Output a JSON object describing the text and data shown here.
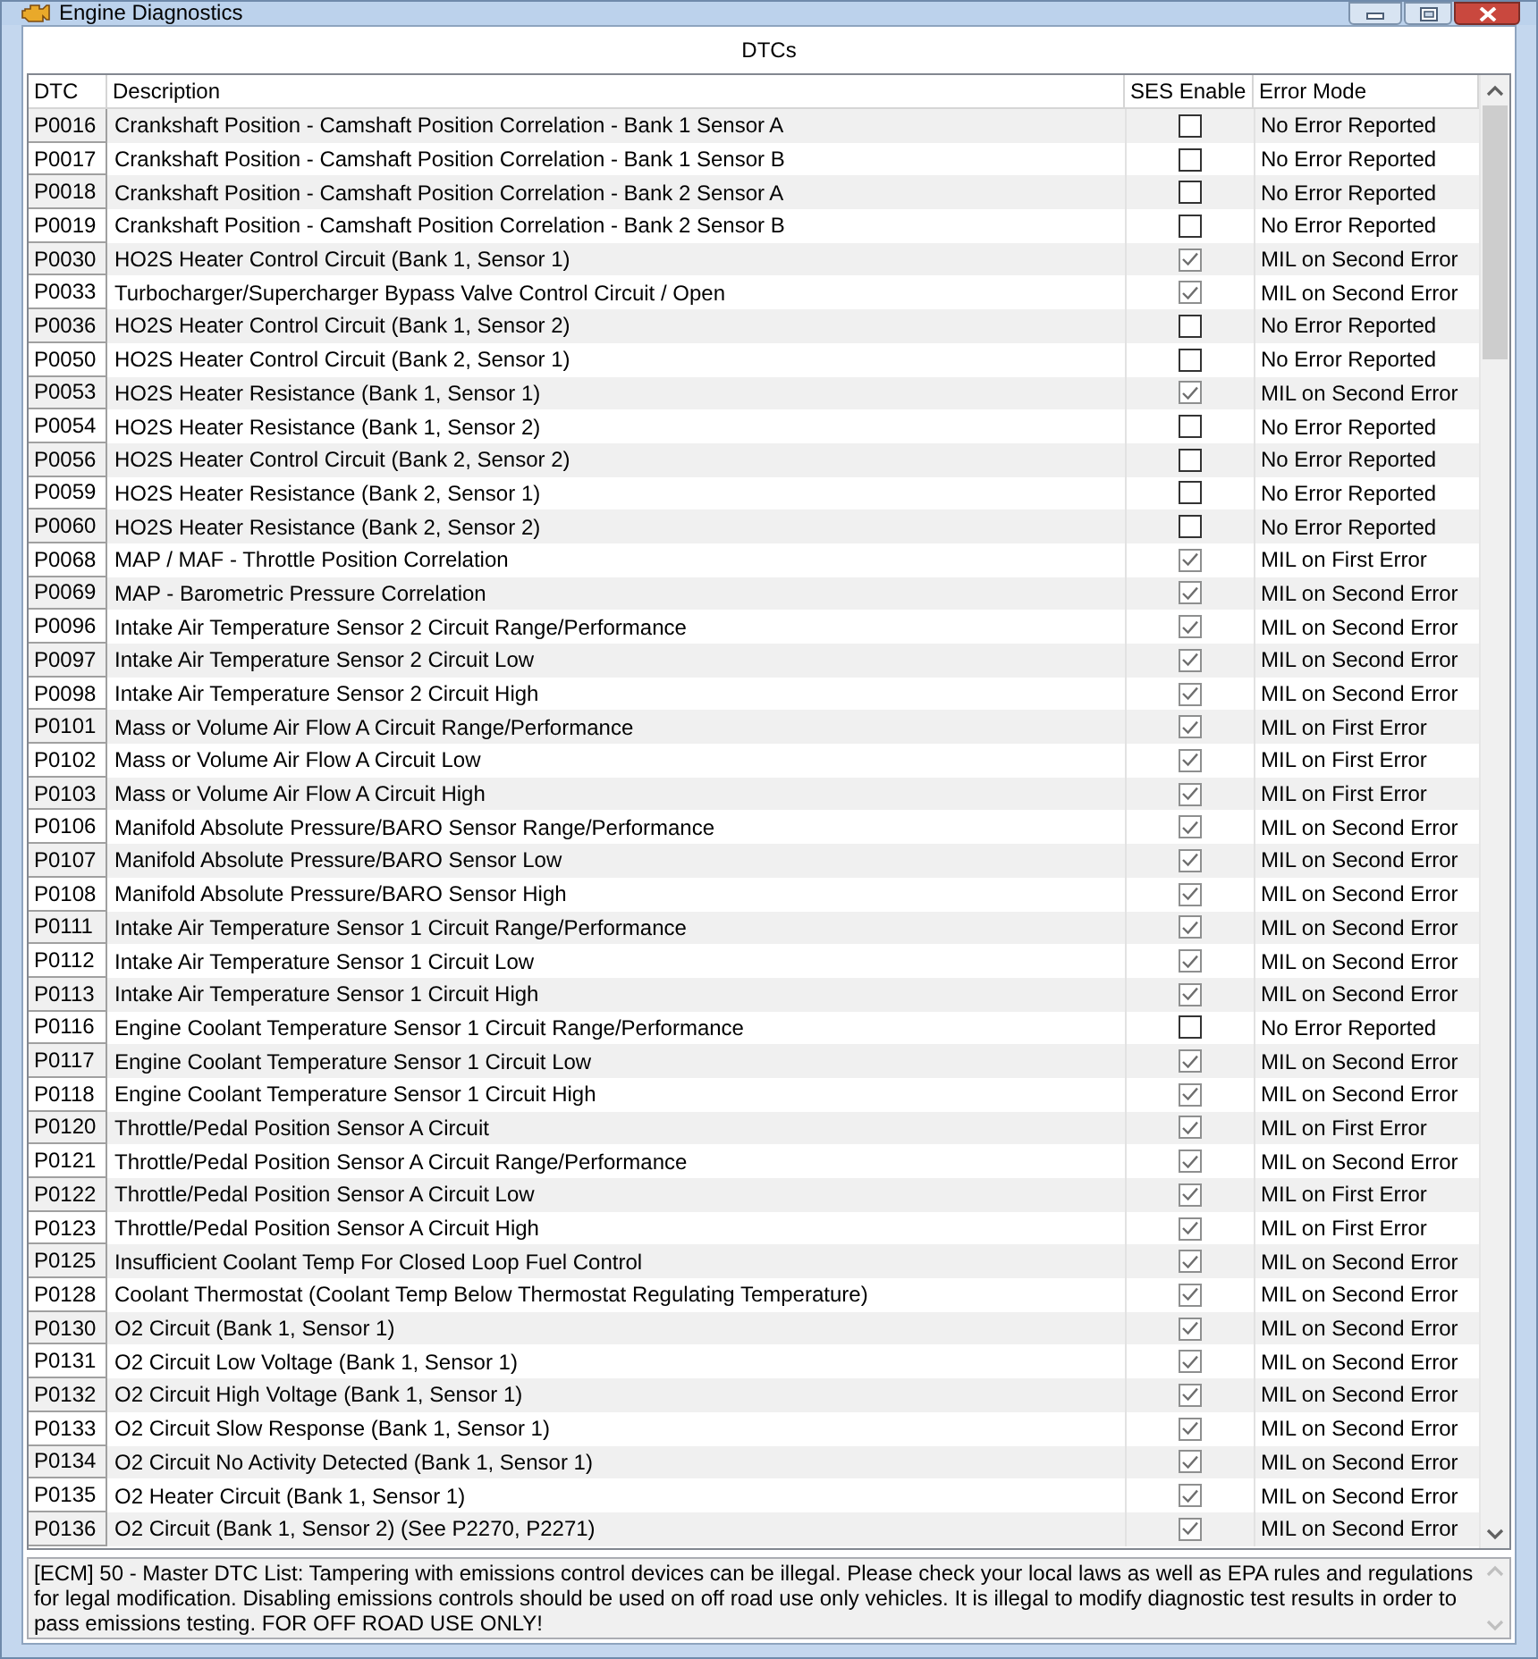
{
  "window": {
    "title": "Engine Diagnostics"
  },
  "panel": {
    "title": "DTCs"
  },
  "table": {
    "columns": [
      "DTC",
      "Description",
      "SES Enable",
      "Error Mode"
    ],
    "rows": [
      {
        "dtc": "P0016",
        "description": "Crankshaft Position - Camshaft Position Correlation - Bank 1 Sensor A",
        "checked": false,
        "error_mode": "No Error Reported"
      },
      {
        "dtc": "P0017",
        "description": "Crankshaft Position - Camshaft Position Correlation - Bank 1 Sensor B",
        "checked": false,
        "error_mode": "No Error Reported"
      },
      {
        "dtc": "P0018",
        "description": "Crankshaft Position - Camshaft Position Correlation - Bank 2 Sensor A",
        "checked": false,
        "error_mode": "No Error Reported"
      },
      {
        "dtc": "P0019",
        "description": "Crankshaft Position - Camshaft Position Correlation - Bank 2 Sensor B",
        "checked": false,
        "error_mode": "No Error Reported"
      },
      {
        "dtc": "P0030",
        "description": "HO2S Heater Control Circuit (Bank 1, Sensor 1)",
        "checked": true,
        "error_mode": "MIL on Second Error"
      },
      {
        "dtc": "P0033",
        "description": "Turbocharger/Supercharger Bypass Valve Control Circuit / Open",
        "checked": true,
        "error_mode": "MIL on Second Error"
      },
      {
        "dtc": "P0036",
        "description": "HO2S Heater Control Circuit (Bank 1, Sensor 2)",
        "checked": false,
        "error_mode": "No Error Reported"
      },
      {
        "dtc": "P0050",
        "description": "HO2S Heater Control Circuit (Bank 2, Sensor 1)",
        "checked": false,
        "error_mode": "No Error Reported"
      },
      {
        "dtc": "P0053",
        "description": "HO2S Heater Resistance (Bank 1, Sensor 1)",
        "checked": true,
        "error_mode": "MIL on Second Error"
      },
      {
        "dtc": "P0054",
        "description": "HO2S Heater Resistance (Bank 1, Sensor 2)",
        "checked": false,
        "error_mode": "No Error Reported"
      },
      {
        "dtc": "P0056",
        "description": "HO2S Heater Control Circuit (Bank 2, Sensor 2)",
        "checked": false,
        "error_mode": "No Error Reported"
      },
      {
        "dtc": "P0059",
        "description": "HO2S Heater Resistance (Bank 2, Sensor 1)",
        "checked": false,
        "error_mode": "No Error Reported"
      },
      {
        "dtc": "P0060",
        "description": "HO2S Heater Resistance (Bank 2, Sensor 2)",
        "checked": false,
        "error_mode": "No Error Reported"
      },
      {
        "dtc": "P0068",
        "description": "MAP / MAF - Throttle Position Correlation",
        "checked": true,
        "error_mode": "MIL on First Error"
      },
      {
        "dtc": "P0069",
        "description": "MAP - Barometric Pressure Correlation",
        "checked": true,
        "error_mode": "MIL on Second Error"
      },
      {
        "dtc": "P0096",
        "description": "Intake Air Temperature Sensor 2 Circuit Range/Performance",
        "checked": true,
        "error_mode": "MIL on Second Error"
      },
      {
        "dtc": "P0097",
        "description": "Intake Air Temperature Sensor 2 Circuit Low",
        "checked": true,
        "error_mode": "MIL on Second Error"
      },
      {
        "dtc": "P0098",
        "description": "Intake Air Temperature Sensor 2 Circuit High",
        "checked": true,
        "error_mode": "MIL on Second Error"
      },
      {
        "dtc": "P0101",
        "description": "Mass or Volume Air Flow A Circuit Range/Performance",
        "checked": true,
        "error_mode": "MIL on First Error"
      },
      {
        "dtc": "P0102",
        "description": "Mass or Volume Air Flow A Circuit Low",
        "checked": true,
        "error_mode": "MIL on First Error"
      },
      {
        "dtc": "P0103",
        "description": "Mass or Volume Air Flow A Circuit High",
        "checked": true,
        "error_mode": "MIL on First Error"
      },
      {
        "dtc": "P0106",
        "description": "Manifold Absolute Pressure/BARO Sensor Range/Performance",
        "checked": true,
        "error_mode": "MIL on Second Error"
      },
      {
        "dtc": "P0107",
        "description": "Manifold Absolute Pressure/BARO Sensor Low",
        "checked": true,
        "error_mode": "MIL on Second Error"
      },
      {
        "dtc": "P0108",
        "description": "Manifold Absolute Pressure/BARO Sensor High",
        "checked": true,
        "error_mode": "MIL on Second Error"
      },
      {
        "dtc": "P0111",
        "description": "Intake Air Temperature Sensor 1 Circuit Range/Performance",
        "checked": true,
        "error_mode": "MIL on Second Error"
      },
      {
        "dtc": "P0112",
        "description": "Intake Air Temperature Sensor 1 Circuit Low",
        "checked": true,
        "error_mode": "MIL on Second Error"
      },
      {
        "dtc": "P0113",
        "description": "Intake Air Temperature Sensor 1 Circuit High",
        "checked": true,
        "error_mode": "MIL on Second Error"
      },
      {
        "dtc": "P0116",
        "description": "Engine Coolant Temperature Sensor 1 Circuit Range/Performance",
        "checked": false,
        "error_mode": "No Error Reported"
      },
      {
        "dtc": "P0117",
        "description": "Engine Coolant Temperature Sensor 1 Circuit Low",
        "checked": true,
        "error_mode": "MIL on Second Error"
      },
      {
        "dtc": "P0118",
        "description": "Engine Coolant Temperature Sensor 1 Circuit High",
        "checked": true,
        "error_mode": "MIL on Second Error"
      },
      {
        "dtc": "P0120",
        "description": "Throttle/Pedal Position Sensor A Circuit",
        "checked": true,
        "error_mode": "MIL on First Error"
      },
      {
        "dtc": "P0121",
        "description": "Throttle/Pedal Position Sensor A Circuit Range/Performance",
        "checked": true,
        "error_mode": "MIL on Second Error"
      },
      {
        "dtc": "P0122",
        "description": "Throttle/Pedal Position Sensor A Circuit Low",
        "checked": true,
        "error_mode": "MIL on First Error"
      },
      {
        "dtc": "P0123",
        "description": "Throttle/Pedal Position Sensor A Circuit High",
        "checked": true,
        "error_mode": "MIL on First Error"
      },
      {
        "dtc": "P0125",
        "description": "Insufficient Coolant Temp For Closed Loop Fuel Control",
        "checked": true,
        "error_mode": "MIL on Second Error"
      },
      {
        "dtc": "P0128",
        "description": "Coolant Thermostat (Coolant Temp Below Thermostat Regulating Temperature)",
        "checked": true,
        "error_mode": "MIL on Second Error"
      },
      {
        "dtc": "P0130",
        "description": "O2 Circuit (Bank 1, Sensor 1)",
        "checked": true,
        "error_mode": "MIL on Second Error"
      },
      {
        "dtc": "P0131",
        "description": "O2 Circuit Low Voltage (Bank 1, Sensor 1)",
        "checked": true,
        "error_mode": "MIL on Second Error"
      },
      {
        "dtc": "P0132",
        "description": "O2 Circuit High Voltage (Bank 1, Sensor 1)",
        "checked": true,
        "error_mode": "MIL on Second Error"
      },
      {
        "dtc": "P0133",
        "description": "O2 Circuit Slow Response (Bank 1, Sensor 1)",
        "checked": true,
        "error_mode": "MIL on Second Error"
      },
      {
        "dtc": "P0134",
        "description": "O2 Circuit No Activity Detected (Bank 1, Sensor 1)",
        "checked": true,
        "error_mode": "MIL on Second Error"
      },
      {
        "dtc": "P0135",
        "description": "O2 Heater Circuit (Bank 1, Sensor 1)",
        "checked": true,
        "error_mode": "MIL on Second Error"
      },
      {
        "dtc": "P0136",
        "description": "O2 Circuit (Bank 1, Sensor 2) (See P2270, P2271)",
        "checked": true,
        "error_mode": "MIL on Second Error"
      }
    ]
  },
  "message": "[ECM] 50 - Master DTC List: Tampering with emissions control devices can be illegal. Please check your local laws as well as EPA rules and regulations for legal modification. Disabling emissions controls should be used on off road use only vehicles. It is illegal to modify diagnostic test results in order to pass emissions testing. FOR OFF ROAD USE ONLY!"
}
